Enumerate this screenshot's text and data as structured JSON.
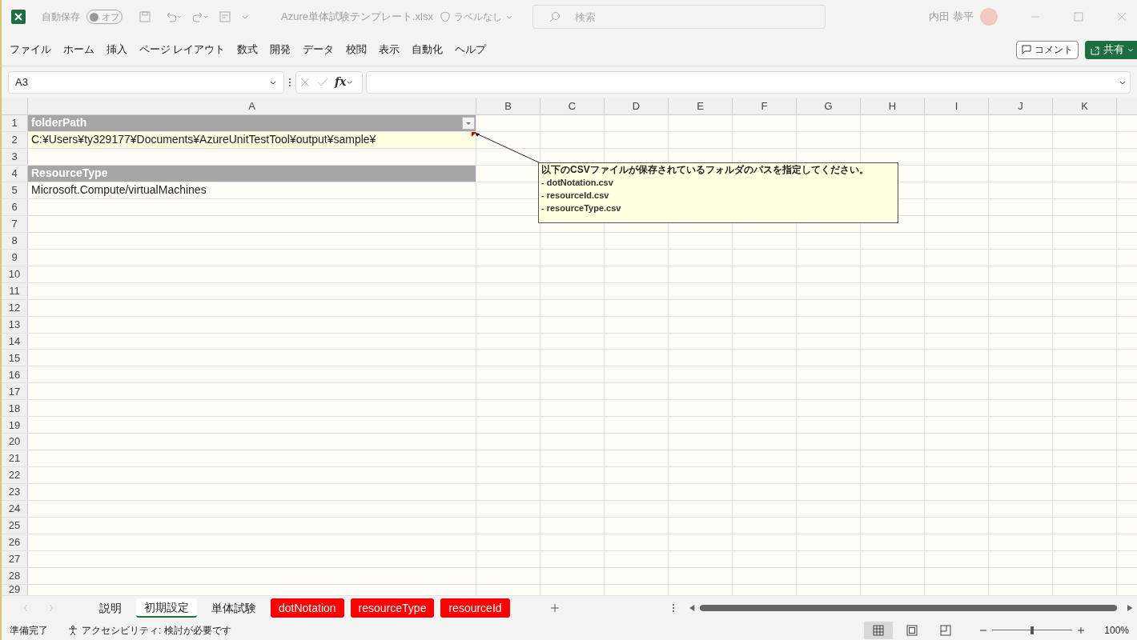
{
  "title_bar": {
    "autosave_label": "自動保存",
    "autosave_toggle": {
      "label": "オフ",
      "on": false
    },
    "file_name": "Azure単体試験テンプレート.xlsx",
    "sensitivity": "ラベルなし",
    "search": {
      "placeholder": "検索"
    },
    "user_name": "内田 恭平"
  },
  "ribbon_tabs": [
    "ファイル",
    "ホーム",
    "挿入",
    "ページ レイアウト",
    "数式",
    "開発",
    "データ",
    "校閲",
    "表示",
    "自動化",
    "ヘルプ"
  ],
  "actions": {
    "comment": "コメント",
    "share": "共有"
  },
  "formula_bar": {
    "name_box": "A3",
    "fx": "fx"
  },
  "sheet": {
    "columns": [
      "A",
      "B",
      "C",
      "D",
      "E",
      "F",
      "G",
      "H",
      "I",
      "J",
      "K"
    ],
    "rows": [
      {
        "number": "1",
        "kind": "header",
        "value": "folderPath",
        "filter": true
      },
      {
        "number": "2",
        "kind": "input",
        "value": "C:¥Users¥ty329177¥Documents¥AzureUnitTestTool¥output¥sample¥"
      },
      {
        "number": "3",
        "kind": "blank"
      },
      {
        "number": "4",
        "kind": "header",
        "value": "ResourceType",
        "filter": false
      },
      {
        "number": "5",
        "kind": "text",
        "value": "Microsoft.Compute/virtualMachines"
      },
      {
        "number": "6",
        "kind": "blank"
      },
      {
        "number": "7",
        "kind": "blank"
      },
      {
        "number": "8",
        "kind": "blank"
      },
      {
        "number": "9",
        "kind": "blank"
      },
      {
        "number": "10",
        "kind": "blank"
      },
      {
        "number": "11",
        "kind": "blank"
      },
      {
        "number": "12",
        "kind": "blank"
      },
      {
        "number": "13",
        "kind": "blank"
      },
      {
        "number": "14",
        "kind": "blank"
      },
      {
        "number": "15",
        "kind": "blank"
      },
      {
        "number": "16",
        "kind": "blank"
      },
      {
        "number": "17",
        "kind": "blank"
      },
      {
        "number": "18",
        "kind": "blank"
      },
      {
        "number": "19",
        "kind": "blank"
      },
      {
        "number": "20",
        "kind": "blank"
      },
      {
        "number": "21",
        "kind": "blank"
      },
      {
        "number": "22",
        "kind": "blank"
      },
      {
        "number": "23",
        "kind": "blank"
      },
      {
        "number": "24",
        "kind": "blank"
      },
      {
        "number": "25",
        "kind": "blank"
      },
      {
        "number": "26",
        "kind": "blank"
      },
      {
        "number": "27",
        "kind": "blank"
      },
      {
        "number": "28",
        "kind": "blank"
      },
      {
        "number": "29",
        "kind": "blank"
      }
    ]
  },
  "comment": {
    "lines": [
      "以下のCSVファイルが保存されているフォルダのパスを指定してください。",
      "- dotNotation.csv",
      "- resourceId.csv",
      "- resourceType.csv"
    ]
  },
  "sheet_tabs": [
    {
      "label": "説明",
      "selected": false
    },
    {
      "label": "初期設定",
      "selected": true
    },
    {
      "label": "単体試験",
      "selected": false
    },
    {
      "label": "dotNotation",
      "selected": false,
      "color": "#ff0000"
    },
    {
      "label": "resourceType",
      "selected": false,
      "color": "#ff0000"
    },
    {
      "label": "resourceId",
      "selected": false,
      "color": "#ff0000"
    }
  ],
  "status_bar": {
    "ready": "準備完了",
    "accessibility": "アクセシビリティ: 検討が必要です",
    "views": [
      {
        "kind": "normal",
        "selected": true
      },
      {
        "kind": "page-layout",
        "selected": false
      },
      {
        "kind": "page-break",
        "selected": false
      }
    ],
    "zoom": {
      "level": 0.5,
      "reading": "100%"
    }
  }
}
